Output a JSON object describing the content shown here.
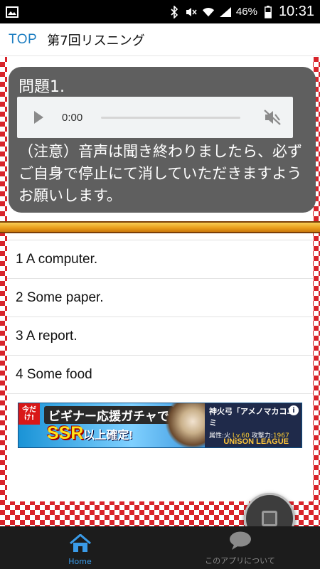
{
  "status_bar": {
    "battery_percent": "46%",
    "time": "10:31",
    "icons": [
      "image-icon",
      "bluetooth-icon",
      "mute-icon",
      "wifi-icon",
      "signal-icon",
      "battery-icon"
    ]
  },
  "header": {
    "top_link": "TOP",
    "title": "第7回リスニング"
  },
  "question": {
    "title": "問題1.",
    "audio": {
      "time": "0:00",
      "progress": 0
    },
    "note": "（注意）音声は聞き終わりましたら、必ずご自身で停止にて消していただきますようお願いします。"
  },
  "answers": [
    {
      "label": "1 A computer."
    },
    {
      "label": "2 Some paper."
    },
    {
      "label": "3 A report."
    },
    {
      "label": "4 Some food"
    }
  ],
  "banner": {
    "badge": "今だけ!",
    "line1": "ビギナー応援ガチャで",
    "line2_main": "SSR",
    "line2_sub": "以上確定!",
    "char_name": "神火弓「アメノマカコユミ",
    "stats_attr": "属性:火",
    "stats_lv": "Lv.60",
    "stats_atk_label": "攻撃力:",
    "stats_atk": "1967",
    "logo": "UNiSON LEAGUE"
  },
  "nav": {
    "home": "Home",
    "about": "このアプリについて"
  },
  "colors": {
    "accent": "#1d7ec2",
    "checker_red": "#d8232a",
    "question_bg": "#5f5f5f",
    "nav_active": "#3a9be8"
  }
}
